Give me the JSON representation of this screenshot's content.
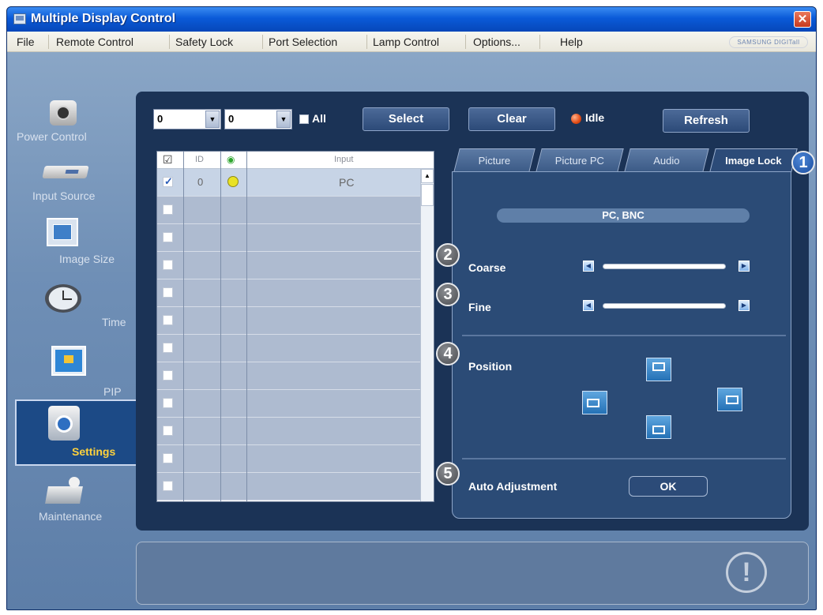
{
  "window": {
    "title": "Multiple Display Control",
    "close_symbol": "✕"
  },
  "menu": {
    "items": [
      "File",
      "Remote Control",
      "Safety Lock",
      "Port Selection",
      "Lamp Control",
      "Options...",
      "Help"
    ],
    "brand": "SAMSUNG DIGITall"
  },
  "sidebar": {
    "items": [
      {
        "label": "Power Control",
        "icon": "power-icon"
      },
      {
        "label": "Input Source",
        "icon": "input-source-icon"
      },
      {
        "label": "Image Size",
        "icon": "image-size-icon"
      },
      {
        "label": "Time",
        "icon": "clock-icon"
      },
      {
        "label": "PIP",
        "icon": "pip-icon"
      },
      {
        "label": "Settings",
        "icon": "settings-icon",
        "active": true
      },
      {
        "label": "Maintenance",
        "icon": "maintenance-icon"
      }
    ]
  },
  "toolbar": {
    "select1_value": "0",
    "select2_value": "0",
    "all_label": "All",
    "select_label": "Select",
    "clear_label": "Clear",
    "status_label": "Idle",
    "refresh_label": "Refresh"
  },
  "grid": {
    "headers": {
      "check": "☑",
      "id": "ID",
      "status": "◉",
      "input": "Input"
    },
    "rows": [
      {
        "checked": true,
        "id": "0",
        "status": "on",
        "input": "PC"
      },
      {
        "checked": false,
        "id": "",
        "status": "",
        "input": ""
      },
      {
        "checked": false,
        "id": "",
        "status": "",
        "input": ""
      },
      {
        "checked": false,
        "id": "",
        "status": "",
        "input": ""
      },
      {
        "checked": false,
        "id": "",
        "status": "",
        "input": ""
      },
      {
        "checked": false,
        "id": "",
        "status": "",
        "input": ""
      },
      {
        "checked": false,
        "id": "",
        "status": "",
        "input": ""
      },
      {
        "checked": false,
        "id": "",
        "status": "",
        "input": ""
      },
      {
        "checked": false,
        "id": "",
        "status": "",
        "input": ""
      },
      {
        "checked": false,
        "id": "",
        "status": "",
        "input": ""
      },
      {
        "checked": false,
        "id": "",
        "status": "",
        "input": ""
      },
      {
        "checked": false,
        "id": "",
        "status": "",
        "input": ""
      }
    ]
  },
  "tabs": [
    "Picture",
    "Picture PC",
    "Audio",
    "Image Lock"
  ],
  "active_tab": "Image Lock",
  "image_lock": {
    "source": "PC, BNC",
    "coarse_label": "Coarse",
    "fine_label": "Fine",
    "position_label": "Position",
    "auto_label": "Auto Adjustment",
    "ok_label": "OK"
  },
  "callouts": [
    "1",
    "2",
    "3",
    "4",
    "5"
  ],
  "warning_symbol": "!"
}
